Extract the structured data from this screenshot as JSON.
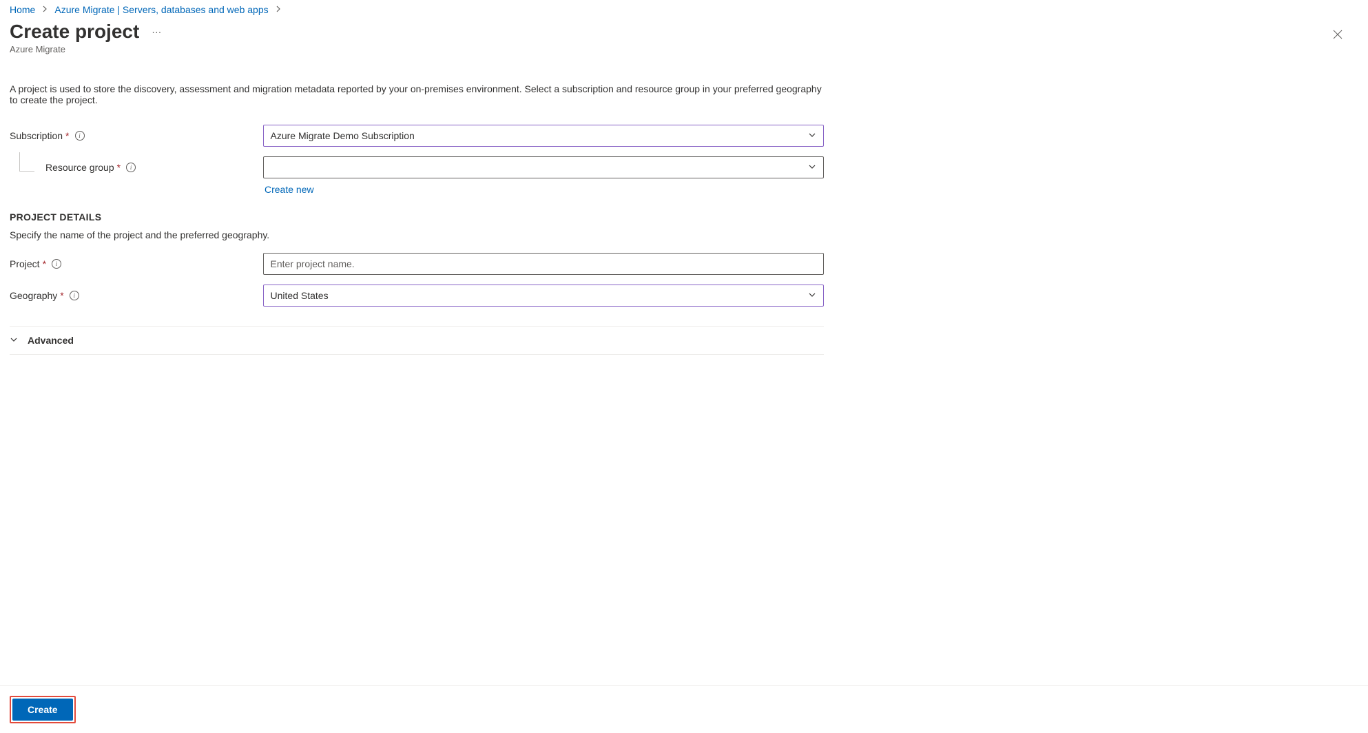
{
  "breadcrumb": {
    "items": [
      "Home",
      "Azure Migrate | Servers, databases and web apps"
    ]
  },
  "header": {
    "title": "Create project",
    "subtitle": "Azure Migrate"
  },
  "intro": "A project is used to store the discovery, assessment and migration metadata reported by your on-premises environment. Select a subscription and resource group in your preferred geography to create the project.",
  "form": {
    "subscription": {
      "label": "Subscription",
      "value": "Azure Migrate Demo Subscription"
    },
    "resource_group": {
      "label": "Resource group",
      "value": "",
      "create_new": "Create new"
    },
    "project_details": {
      "heading": "PROJECT DETAILS",
      "desc": "Specify the name of the project and the preferred geography."
    },
    "project": {
      "label": "Project",
      "placeholder": "Enter project name."
    },
    "geography": {
      "label": "Geography",
      "value": "United States"
    },
    "advanced": {
      "label": "Advanced"
    }
  },
  "footer": {
    "create": "Create"
  }
}
